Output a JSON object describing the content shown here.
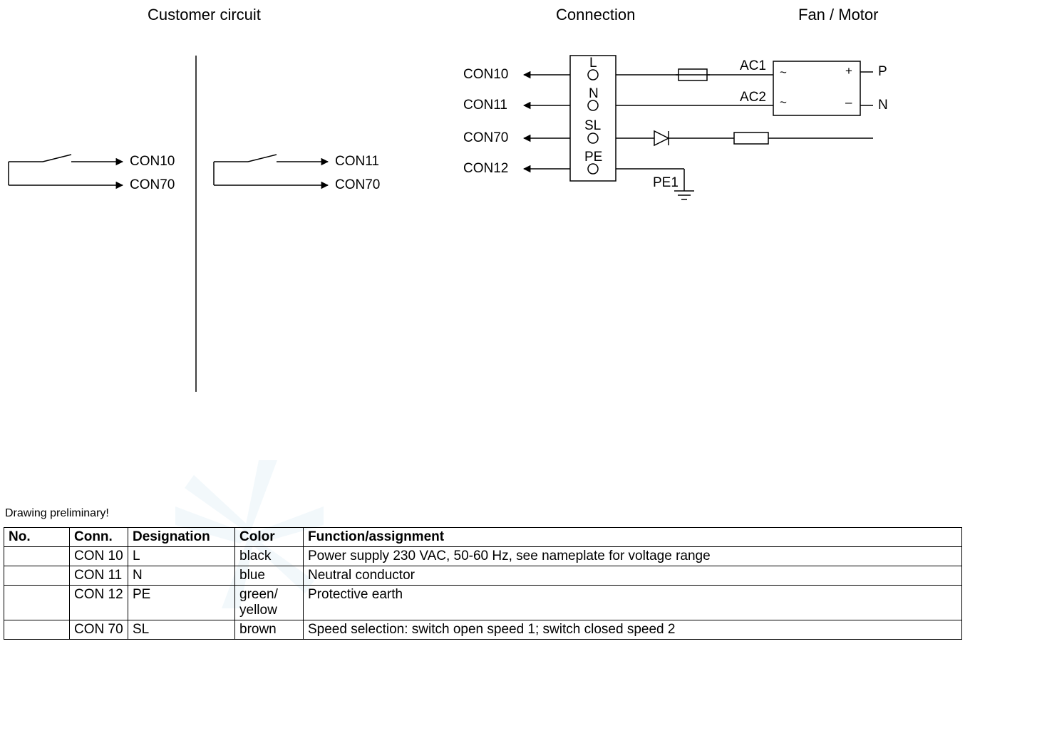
{
  "headers": {
    "customer": "Customer circuit",
    "connection": "Connection",
    "fanmotor": "Fan / Motor"
  },
  "customer_block": {
    "left": {
      "top": "CON10",
      "bottom": "CON70"
    },
    "right": {
      "top": "CON11",
      "bottom": "CON70"
    }
  },
  "connection_block": {
    "rows": {
      "r1": {
        "con": "CON10",
        "term": "L"
      },
      "r2": {
        "con": "CON11",
        "term": "N"
      },
      "r3": {
        "con": "CON70",
        "term": "SL"
      },
      "r4": {
        "con": "CON12",
        "term": "PE"
      }
    },
    "ac1": "AC1",
    "ac2": "AC2",
    "pe1": "PE1",
    "motor": {
      "p": "P",
      "n": "N",
      "ac_in1": "~",
      "ac_in2": "~",
      "plus": "+",
      "minus": "–"
    }
  },
  "note": "Drawing preliminary!",
  "table": {
    "headers": {
      "no": "No.",
      "conn": "Conn.",
      "desig": "Designation",
      "color": "Color",
      "func": "Function/assignment"
    },
    "rows": [
      {
        "no": "",
        "conn": "CON 10",
        "desig": "L",
        "color": "black",
        "func": "Power supply 230 VAC, 50-60 Hz, see nameplate for voltage range"
      },
      {
        "no": "",
        "conn": "CON 11",
        "desig": "N",
        "color": "blue",
        "func": "Neutral conductor"
      },
      {
        "no": "",
        "conn": "CON 12",
        "desig": "PE",
        "color": "green/ yellow",
        "func": "Protective earth"
      },
      {
        "no": "",
        "conn": "CON 70",
        "desig": "SL",
        "color": "brown",
        "func": "Speed selection: switch open speed 1; switch closed speed 2"
      }
    ]
  }
}
